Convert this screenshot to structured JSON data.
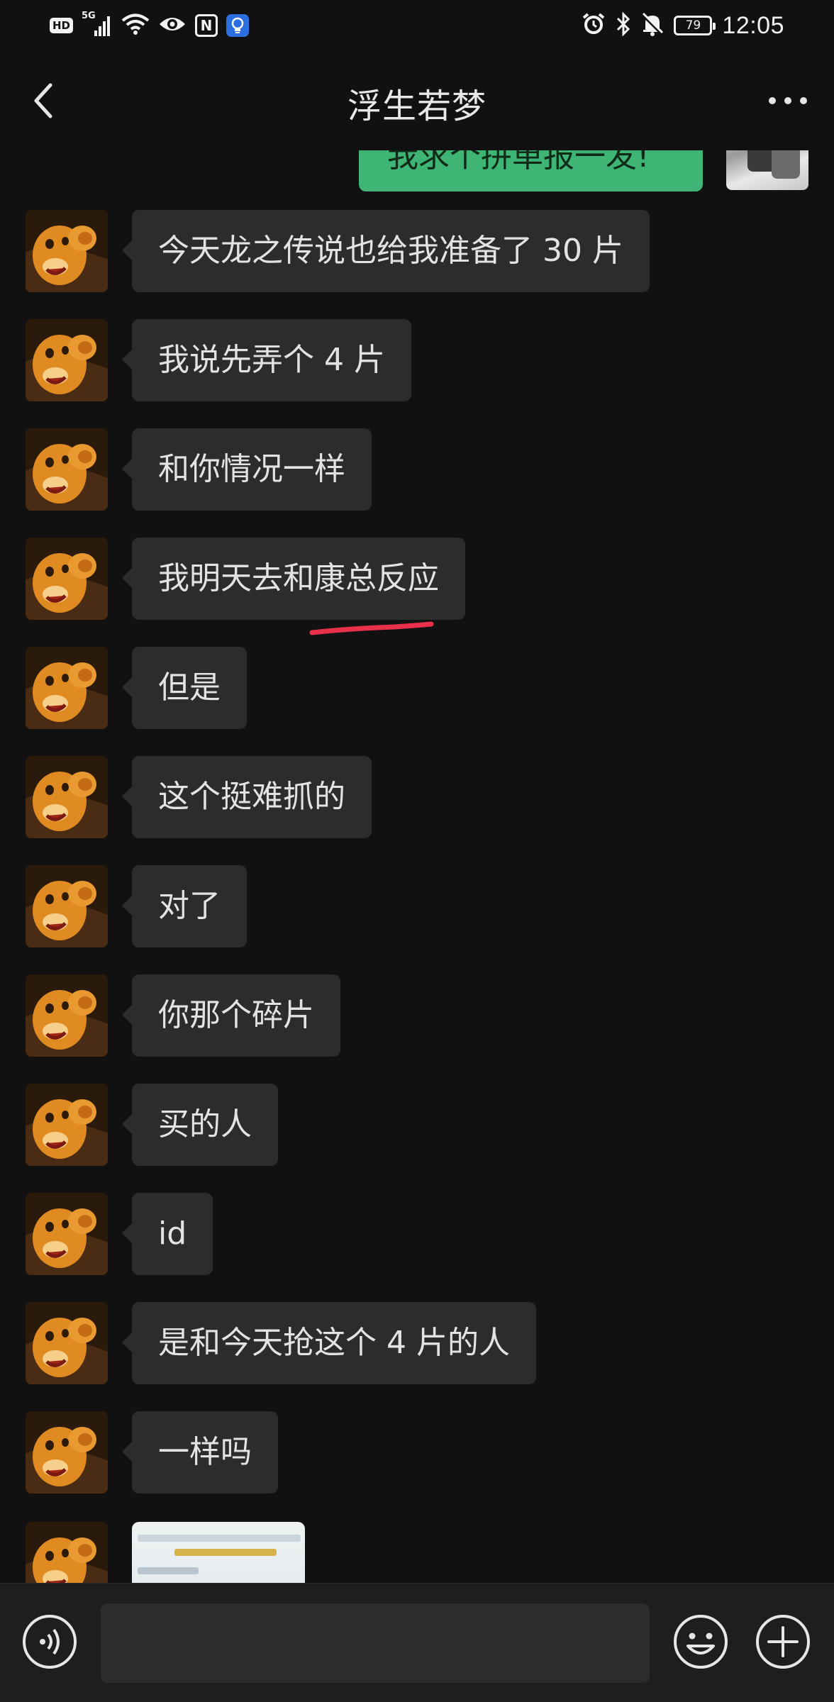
{
  "status_bar": {
    "left_icons": [
      "hd-icon",
      "signal-5g-icon",
      "wifi-icon",
      "eye-icon",
      "nfc-icon",
      "bulb-icon"
    ],
    "hd_label": "HD",
    "network_label": "5G",
    "nfc_label": "N",
    "right_icons": [
      "alarm-icon",
      "bluetooth-icon",
      "mute-bell-icon",
      "battery-icon"
    ],
    "battery_level": "79",
    "time": "12:05"
  },
  "header": {
    "title": "浮生若梦",
    "back_icon": "chevron-left-icon",
    "more_icon": "more-dots-icon"
  },
  "messages": {
    "sent_partial": {
      "text": "我求个拼单报一发!"
    },
    "received": [
      {
        "text": "今天龙之传说也给我准备了 30 片"
      },
      {
        "text": "我说先弄个 4 片"
      },
      {
        "text": "和你情况一样"
      },
      {
        "text": "我明天去和康总反应"
      },
      {
        "text": "但是"
      },
      {
        "text": "这个挺难抓的"
      },
      {
        "text": "对了"
      },
      {
        "text": "你那个碎片"
      },
      {
        "text": "买的人"
      },
      {
        "text": "id"
      },
      {
        "text": "是和今天抢这个 4 片的人"
      },
      {
        "text": "一样吗"
      }
    ],
    "image_message": {
      "type": "screenshot-thumbnail"
    }
  },
  "colors": {
    "background": "#111111",
    "received_bubble": "#2c2c2c",
    "sent_bubble": "#3eb575",
    "highlight_underline": "#e8304a",
    "input_bar": "#1e1e1e"
  },
  "input_bar": {
    "value": "",
    "voice_icon": "voice-icon",
    "emoji_icon": "emoji-icon",
    "plus_icon": "plus-circle-icon"
  }
}
